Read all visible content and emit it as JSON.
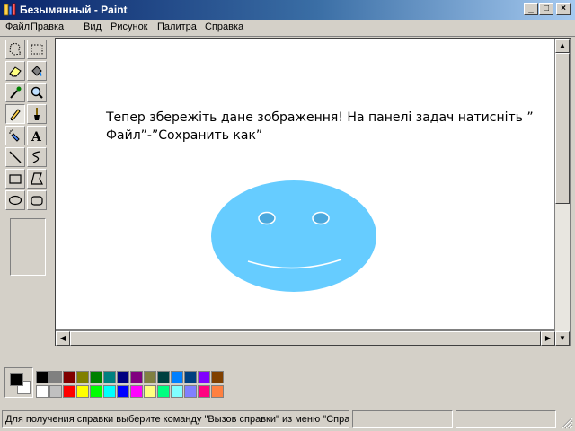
{
  "window": {
    "title": "Безымянный - Paint"
  },
  "title_buttons": {
    "minimize": "_",
    "maximize": "□",
    "close": "×"
  },
  "menu": [
    {
      "underline": "Ф",
      "rest": "айл"
    },
    {
      "underline": "П",
      "rest": "равка"
    },
    {
      "underline": "В",
      "rest": "ид"
    },
    {
      "underline": "Р",
      "rest": "исунок"
    },
    {
      "underline": "П",
      "rest": "алитра"
    },
    {
      "underline": "С",
      "rest": "правка"
    }
  ],
  "tools": [
    "free-select",
    "rect-select",
    "eraser",
    "fill",
    "color-picker",
    "magnifier",
    "pencil",
    "brush",
    "airbrush",
    "text",
    "line",
    "curve",
    "rectangle",
    "polygon",
    "ellipse",
    "rounded-rectangle"
  ],
  "active_tool": "pencil",
  "canvas": {
    "instruction_line1": "Тепер збережіть дане зображення! На панелі задач натисніть ”",
    "instruction_line2": "Файл”-”Сохранить как”",
    "smiley_color": "#66ccff",
    "eye_color": "#4aa8dd"
  },
  "palette": {
    "foreground": "#000000",
    "background": "#ffffff",
    "row1": [
      "#000000",
      "#808080",
      "#800000",
      "#808000",
      "#008000",
      "#008080",
      "#000080",
      "#800080",
      "#808040",
      "#004040",
      "#0080ff",
      "#004080",
      "#8000ff",
      "#804000"
    ],
    "row2": [
      "#ffffff",
      "#c0c0c0",
      "#ff0000",
      "#ffff00",
      "#00ff00",
      "#00ffff",
      "#0000ff",
      "#ff00ff",
      "#ffff80",
      "#00ff80",
      "#80ffff",
      "#8080ff",
      "#ff0080",
      "#ff8040"
    ]
  },
  "status": {
    "help_text": "Для получения справки выберите команду \"Вызов справки\" из меню \"Справка\"."
  }
}
